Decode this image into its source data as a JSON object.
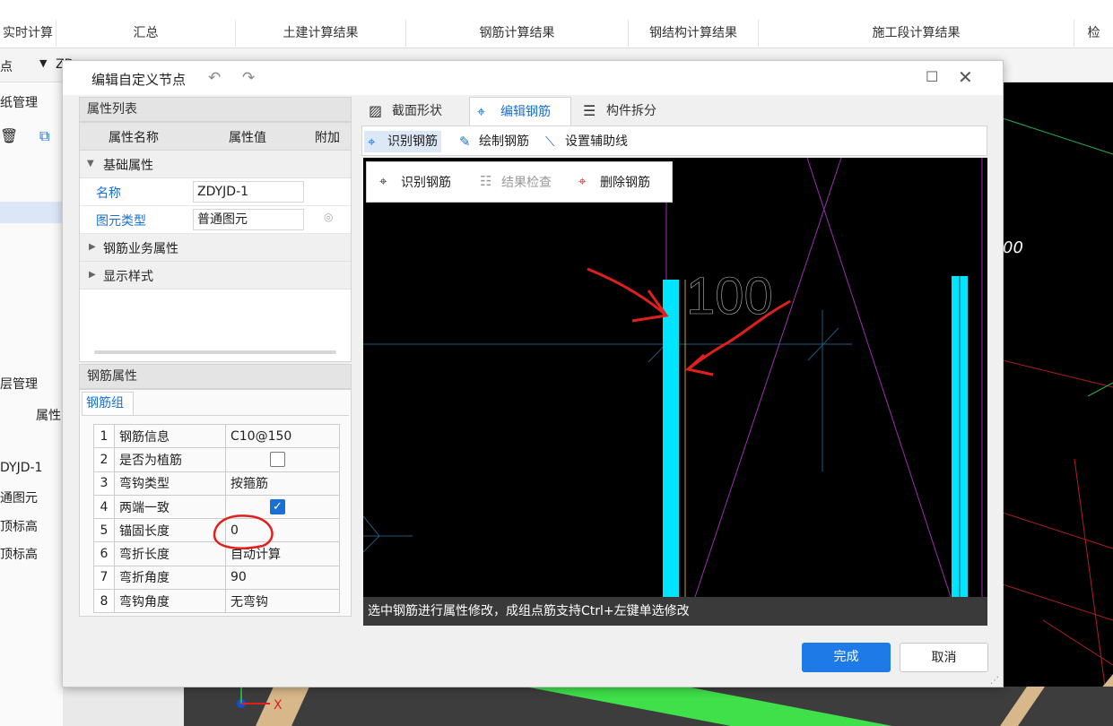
{
  "ribbon": {
    "tabs": [
      "实时计算",
      "汇总",
      "土建计算结果",
      "钢筋计算结果",
      "钢结构计算结果",
      "施工段计算结果",
      "检"
    ]
  },
  "toolbar2": {
    "left_label": "点",
    "combo_value": "ZD"
  },
  "left_panel": {
    "drawing_mgmt": "纸管理",
    "layer_mgmt": "层管理",
    "col_header": "属性",
    "values": [
      "DYJD-1",
      "通图元",
      "顶标高",
      "顶标高"
    ]
  },
  "cad": {
    "side_text": "00",
    "axis_x_label": "X"
  },
  "dialog": {
    "title": "编辑自定义节点",
    "prop_list_header": "属性列表",
    "prop_cols": {
      "name": "属性名称",
      "value": "属性值",
      "extra": "附加"
    },
    "groups": {
      "basic": "基础属性",
      "rebar_business": "钢筋业务属性",
      "display": "显示样式"
    },
    "props": [
      {
        "name": "名称",
        "value": "ZDYJD-1"
      },
      {
        "name": "图元类型",
        "value": "普通图元"
      }
    ],
    "rebar_attr_header": "钢筋属性",
    "rebar_group_tab": "钢筋组",
    "rebar_rows": [
      {
        "num": "1",
        "name": "钢筋信息",
        "value": "C10@150"
      },
      {
        "num": "2",
        "name": "是否为植筋",
        "value": "",
        "checkbox": false
      },
      {
        "num": "3",
        "name": "弯钩类型",
        "value": "按箍筋"
      },
      {
        "num": "4",
        "name": "两端一致",
        "value": "",
        "checkbox": true
      },
      {
        "num": "5",
        "name": "锚固长度",
        "value": "0"
      },
      {
        "num": "6",
        "name": "弯折长度",
        "value": "自动计算"
      },
      {
        "num": "7",
        "name": "弯折角度",
        "value": "90"
      },
      {
        "num": "8",
        "name": "弯钩角度",
        "value": "无弯钩"
      }
    ],
    "main_tabs": [
      "截面形状",
      "编辑钢筋",
      "构件拆分"
    ],
    "sub_tools": [
      "识别钢筋",
      "绘制钢筋",
      "设置辅助线"
    ],
    "float_tools": [
      "识别钢筋",
      "结果检查",
      "删除钢筋"
    ],
    "canvas_label": "100",
    "status": "选中钢筋进行属性修改，成组点筋支持Ctrl+左键单选修改",
    "ok": "完成",
    "cancel": "取消"
  },
  "colors": {
    "accent": "#1e7ae6",
    "rebar": "#00e5ff",
    "annotation": "#e0201c",
    "guide": "#9b2fae"
  }
}
